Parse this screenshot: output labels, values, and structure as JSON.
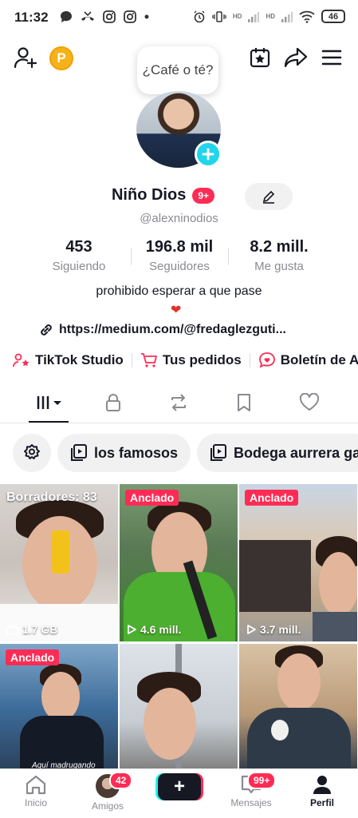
{
  "status_bar": {
    "time": "11:32",
    "battery": "46",
    "hd1": "HD",
    "hd2": "HD"
  },
  "top_bar": {
    "coin_label": "P",
    "bubble_text": "¿Café o té?"
  },
  "profile": {
    "name": "Niño Dios",
    "name_badge": "9+",
    "handle": "@alexninodios",
    "stats": [
      {
        "value": "453",
        "label": "Siguiendo"
      },
      {
        "value": "196.8 mil",
        "label": "Seguidores"
      },
      {
        "value": "8.2 mill.",
        "label": "Me gusta"
      }
    ],
    "bio": "prohibido esperar a que pase",
    "bio_emoji": "❤",
    "link": "https://medium.com/@fredaglezguti..."
  },
  "quick_links": [
    {
      "label": "TikTok Studio"
    },
    {
      "label": "Tus pedidos"
    },
    {
      "label": "Boletín de A"
    }
  ],
  "chips": [
    {
      "label": "los famosos"
    },
    {
      "label": "Bodega aurrera ga"
    }
  ],
  "videos": [
    {
      "tag": "Borradores: 83",
      "count": "1.7 GB",
      "pinned": false
    },
    {
      "tag": "Anclado",
      "count": "4.6 mill.",
      "pinned": true
    },
    {
      "tag": "Anclado",
      "count": "3.7 mill.",
      "pinned": true
    },
    {
      "tag": "Anclado",
      "count": "",
      "pinned": true,
      "caption": "Aquí madrugando"
    },
    {
      "tag": "",
      "count": ""
    },
    {
      "tag": "",
      "count": ""
    }
  ],
  "bottom_nav": {
    "home": "Inicio",
    "friends": "Amigos",
    "friends_badge": "42",
    "plus": "+",
    "inbox": "Mensajes",
    "inbox_badge": "99+",
    "profile": "Perfil"
  },
  "colors": {
    "accent": "#fe2c55",
    "cyan": "#20d5ec",
    "coin": "#f6b21a"
  }
}
